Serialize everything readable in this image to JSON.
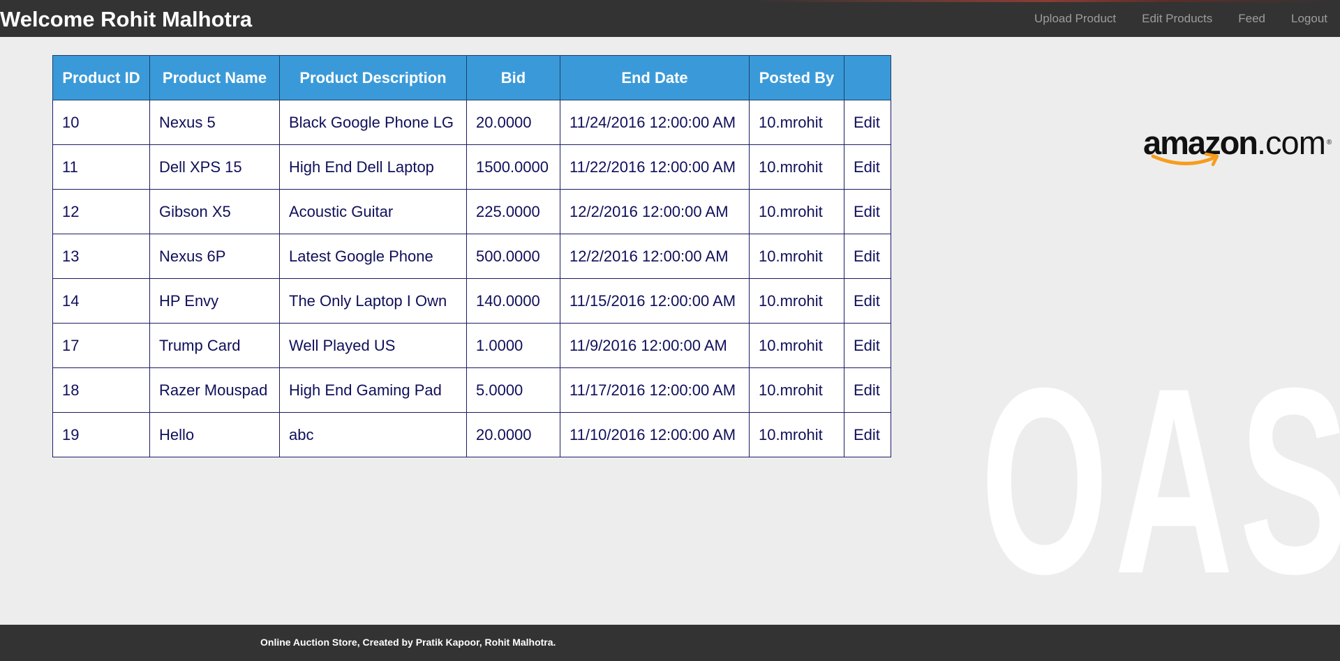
{
  "header": {
    "welcome": "Welcome Rohit Malhotra",
    "nav": [
      {
        "label": "Upload Product"
      },
      {
        "label": "Edit Products"
      },
      {
        "label": "Feed"
      },
      {
        "label": "Logout"
      }
    ]
  },
  "table": {
    "columns": [
      "Product ID",
      "Product Name",
      "Product Description",
      "Bid",
      "End Date",
      "Posted By",
      ""
    ],
    "rows": [
      {
        "id": "10",
        "name": "Nexus 5",
        "description": "Black Google Phone LG",
        "bid": "20.0000",
        "end_date": "11/24/2016 12:00:00 AM",
        "posted_by": "10.mrohit",
        "action": "Edit"
      },
      {
        "id": "11",
        "name": "Dell XPS 15",
        "description": "High End Dell Laptop",
        "bid": "1500.0000",
        "end_date": "11/22/2016 12:00:00 AM",
        "posted_by": "10.mrohit",
        "action": "Edit"
      },
      {
        "id": "12",
        "name": "Gibson X5",
        "description": "Acoustic Guitar",
        "bid": "225.0000",
        "end_date": "12/2/2016 12:00:00 AM",
        "posted_by": "10.mrohit",
        "action": "Edit"
      },
      {
        "id": "13",
        "name": "Nexus 6P",
        "description": "Latest Google Phone",
        "bid": "500.0000",
        "end_date": "12/2/2016 12:00:00 AM",
        "posted_by": "10.mrohit",
        "action": "Edit"
      },
      {
        "id": "14",
        "name": "HP Envy",
        "description": "The Only Laptop I Own",
        "bid": "140.0000",
        "end_date": "11/15/2016 12:00:00 AM",
        "posted_by": "10.mrohit",
        "action": "Edit"
      },
      {
        "id": "17",
        "name": "Trump Card",
        "description": "Well Played US",
        "bid": "1.0000",
        "end_date": "11/9/2016 12:00:00 AM",
        "posted_by": "10.mrohit",
        "action": "Edit"
      },
      {
        "id": "18",
        "name": "Razer Mouspad",
        "description": "High End Gaming Pad",
        "bid": "5.0000",
        "end_date": "11/17/2016 12:00:00 AM",
        "posted_by": "10.mrohit",
        "action": "Edit"
      },
      {
        "id": "19",
        "name": "Hello",
        "description": "abc",
        "bid": "20.0000",
        "end_date": "11/10/2016 12:00:00 AM",
        "posted_by": "10.mrohit",
        "action": "Edit"
      }
    ]
  },
  "logo": {
    "wordmark": "amazon",
    "suffix": ".com"
  },
  "watermark": "OAS",
  "footer": {
    "text": "Online Auction Store, Created by Pratik Kapoor, Rohit Malhotra."
  },
  "colors": {
    "header_bg": "#333333",
    "page_bg": "#ededed",
    "table_header_bg": "#3a9ad9",
    "table_text": "#0f0f5a",
    "nav_text": "#9d9d9d",
    "amazon_orange": "#f79c1c"
  },
  "icons": {
    "logo": "amazon-logo",
    "smile": "amazon-smile-arrow-icon"
  }
}
